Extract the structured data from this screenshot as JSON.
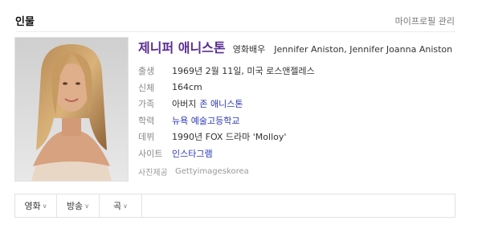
{
  "section": {
    "title": "인물",
    "manage_label": "마이프로필 관리"
  },
  "profile": {
    "name": "제니퍼 애니스톤",
    "occupation": "영화배우",
    "english_name": "Jennifer Aniston, Jennifer Joanna Aniston",
    "photo_alt": "person-photo"
  },
  "details": {
    "birth_label": "출생",
    "birth_value": "1969년 2월 11일, 미국 로스앤젤레스",
    "body_label": "신체",
    "body_value": "164cm",
    "family_label": "가족",
    "family_prefix": "아버지",
    "family_link": "존 애니스톤",
    "education_label": "학력",
    "education_link": "뉴욕 예술고등학교",
    "debut_label": "데뷔",
    "debut_value": "1990년 FOX 드라마 'Molloy'",
    "site_label": "사이트",
    "site_link": "인스타그램",
    "credit_label": "사진제공",
    "credit_value": "Gettyimageskorea"
  },
  "tabs": [
    {
      "label": "영화"
    },
    {
      "label": "방송"
    },
    {
      "label": "곡"
    }
  ],
  "colors": {
    "name": "#5a2d91",
    "link": "#2b3ab5",
    "label": "#888888",
    "border": "#e2e2e2"
  },
  "icons": {
    "dropdown": "chevron-down-icon"
  }
}
